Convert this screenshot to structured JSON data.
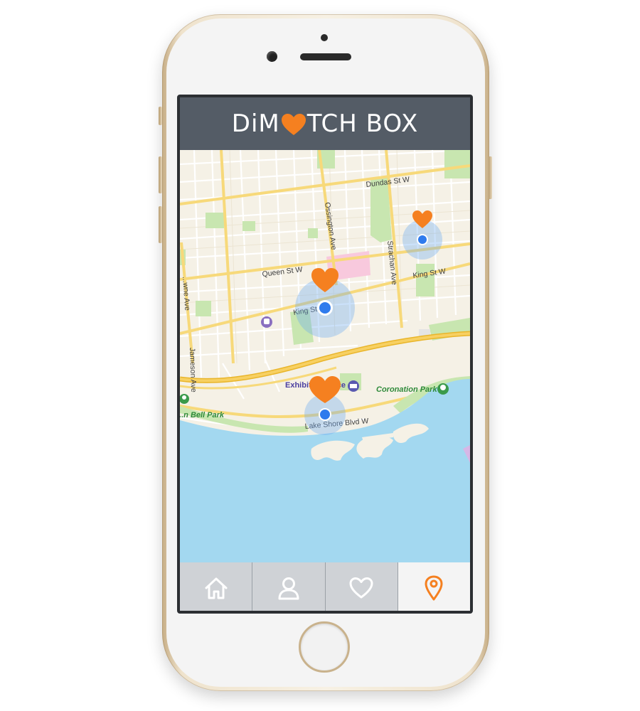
{
  "app": {
    "title_prefix": "DiM",
    "title_suffix": "TCH BOX",
    "brand_color": "#f58020",
    "header_color": "#545c66"
  },
  "map": {
    "streets": {
      "dundas": "Dundas St W",
      "ossington": "Ossington Ave",
      "queen": "Queen St W",
      "strachan": "Strachan Ave",
      "king_east": "King St W",
      "king_west": "King St",
      "jameson": "Jameson Ave",
      "lansdowne": "...wne Ave",
      "lake_shore": "Lake Shore Blvd W"
    },
    "places": {
      "exhibition": "Exhibition Place",
      "coronation_park": "Coronation Park",
      "bell_park": "...n Bell Park"
    },
    "colors": {
      "land": "#f5f1e6",
      "water": "#a3d8f0",
      "park": "#c8e6b0",
      "highway": "#f2c43a",
      "user_dot": "#2f7bed",
      "match_heart": "#f58020"
    }
  },
  "matches": [
    {
      "label": "match-1"
    },
    {
      "label": "match-2"
    },
    {
      "label": "match-3"
    }
  ],
  "tabs": [
    {
      "icon": "home-icon",
      "active": false
    },
    {
      "icon": "profile-icon",
      "active": false
    },
    {
      "icon": "heart-icon",
      "active": false
    },
    {
      "icon": "location-pin-icon",
      "active": true
    }
  ]
}
